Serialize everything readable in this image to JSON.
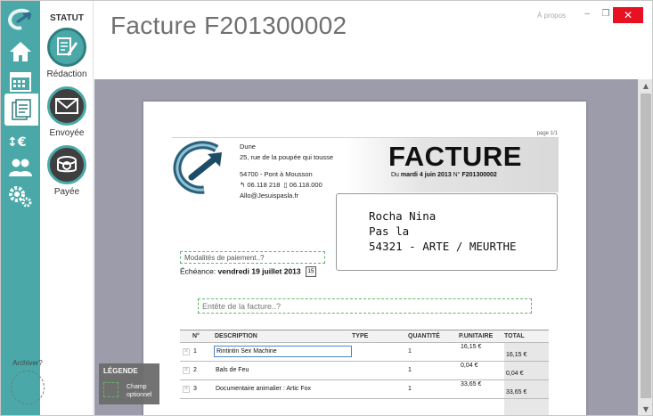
{
  "window": {
    "title": "Facture F201300002",
    "about_link": "À propos",
    "minimize": "‒",
    "restore": "❐",
    "close": "✕"
  },
  "sidebar": {
    "icons": [
      "app-logo-icon",
      "home-icon",
      "calendar-icon",
      "invoices-icon",
      "payments-icon",
      "clients-icon",
      "settings-icon"
    ],
    "active": "invoices-icon"
  },
  "status": {
    "title": "STATUT",
    "items": [
      {
        "label": "Rédaction",
        "icon": "pen-icon",
        "current": true
      },
      {
        "label": "Envoyée",
        "icon": "envelope-icon",
        "current": false
      },
      {
        "label": "Payée",
        "icon": "cash-icon",
        "current": false
      }
    ],
    "archive_label": "Archiver?"
  },
  "invoice": {
    "page_indicator": "page 1/1",
    "company": {
      "name": "Dune",
      "street": "25, rue de la poupée qui tousse",
      "city": "54700 - Pont à Mousson",
      "phone": "06.118 218",
      "fax": "06.118.000",
      "email": "Allo@Jesuispasla.fr"
    },
    "heading": "FACTURE",
    "date_prefix": "Du",
    "date": "mardi 4 juin 2013",
    "number_prefix": "N°",
    "number": "F201300002",
    "recipient": {
      "line1": "Rocha Nina",
      "line2": "Pas la",
      "line3": "54321 - ARTE / MEURTHE"
    },
    "payment_terms_placeholder": "Modalités de paiement..?",
    "due_label": "Échéance:",
    "due_date": "vendredi 19 juillet 2013",
    "calendar_day": "15",
    "header_placeholder": "Entête de la facture..?",
    "table": {
      "columns": [
        "N°",
        "DESCRIPTION",
        "TYPE",
        "QUANTITÉ",
        "P.UNITAIRE",
        "TOTAL"
      ],
      "rows": [
        {
          "n": "1",
          "description": "Rintintin Sex Machine",
          "type": "",
          "qty": "1",
          "unit": "16,15 €",
          "total": "16,15 €"
        },
        {
          "n": "2",
          "description": "Bals de Feu",
          "type": "",
          "qty": "1",
          "unit": "0,04 €",
          "total": "0,04 €"
        },
        {
          "n": "3",
          "description": "Documentaire animalier : Artic Fox",
          "type": "",
          "qty": "1",
          "unit": "33,65 €",
          "total": "33,65 €"
        }
      ]
    }
  },
  "legend": {
    "title": "LÉGENDE",
    "item_line1": "Champ",
    "item_line2": "optionnel",
    "dashed_color": "#62b56a"
  },
  "colors": {
    "accent": "#4aa9a8",
    "close": "#e81123",
    "canvas": "#9c9cab"
  }
}
